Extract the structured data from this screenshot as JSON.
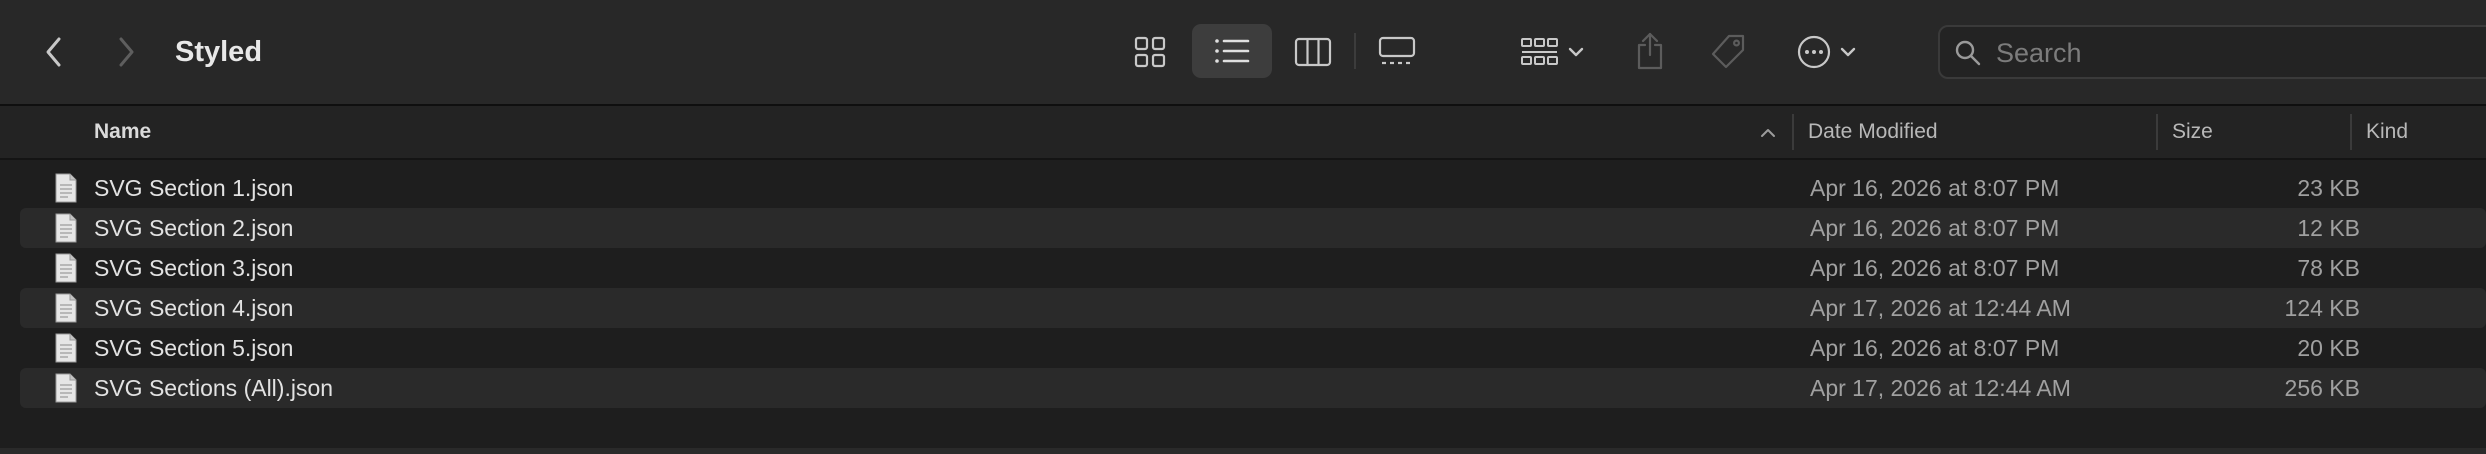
{
  "window": {
    "title": "Styled"
  },
  "search": {
    "placeholder": "Search"
  },
  "columns": {
    "name": "Name",
    "date": "Date Modified",
    "size": "Size",
    "kind": "Kind"
  },
  "files": [
    {
      "name": "SVG Section 1.json",
      "date": "Apr 16, 2026 at 8:07 PM",
      "size": "23 KB"
    },
    {
      "name": "SVG Section 2.json",
      "date": "Apr 16, 2026 at 8:07 PM",
      "size": "12 KB"
    },
    {
      "name": "SVG Section 3.json",
      "date": "Apr 16, 2026 at 8:07 PM",
      "size": "78 KB"
    },
    {
      "name": "SVG Section 4.json",
      "date": "Apr 17, 2026 at 12:44 AM",
      "size": "124 KB"
    },
    {
      "name": "SVG Section 5.json",
      "date": "Apr 16, 2026 at 8:07 PM",
      "size": "20 KB"
    },
    {
      "name": "SVG Sections (All).json",
      "date": "Apr 17, 2026 at 12:44 AM",
      "size": "256 KB"
    }
  ],
  "icons": {
    "back": "chevron-left-icon",
    "forward": "chevron-right-icon",
    "icon_view": "grid-icon",
    "list_view": "list-icon",
    "column_view": "columns-icon",
    "gallery_view": "gallery-icon",
    "group": "group-icon",
    "share": "share-icon",
    "tag": "tag-icon",
    "more": "ellipsis-circle-icon",
    "search": "magnifier-icon",
    "file": "document-icon",
    "sort": "chevron-up-icon"
  },
  "colors": {
    "background": "#1e1e1e",
    "toolbar": "#282828",
    "row_alt": "#2a2a2a",
    "text": "#e2e2e2",
    "secondary_text": "#a0a0a0"
  }
}
